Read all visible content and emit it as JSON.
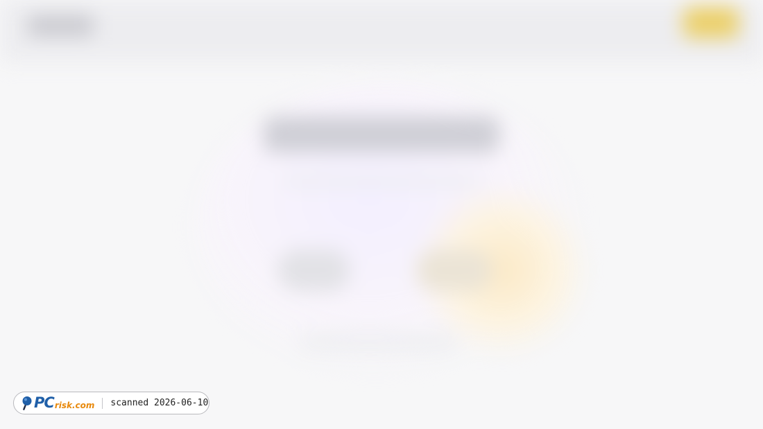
{
  "watermark": {
    "logo_text_main": "PC",
    "logo_text_sub": "risk.com",
    "scan_label": "scanned 2026-06-10"
  },
  "colors": {
    "logo_blue": "#1f5fa8",
    "logo_orange": "#e8890c",
    "header_cta_yellow": "#ecd06a",
    "page_background": "#f7f7f8"
  }
}
